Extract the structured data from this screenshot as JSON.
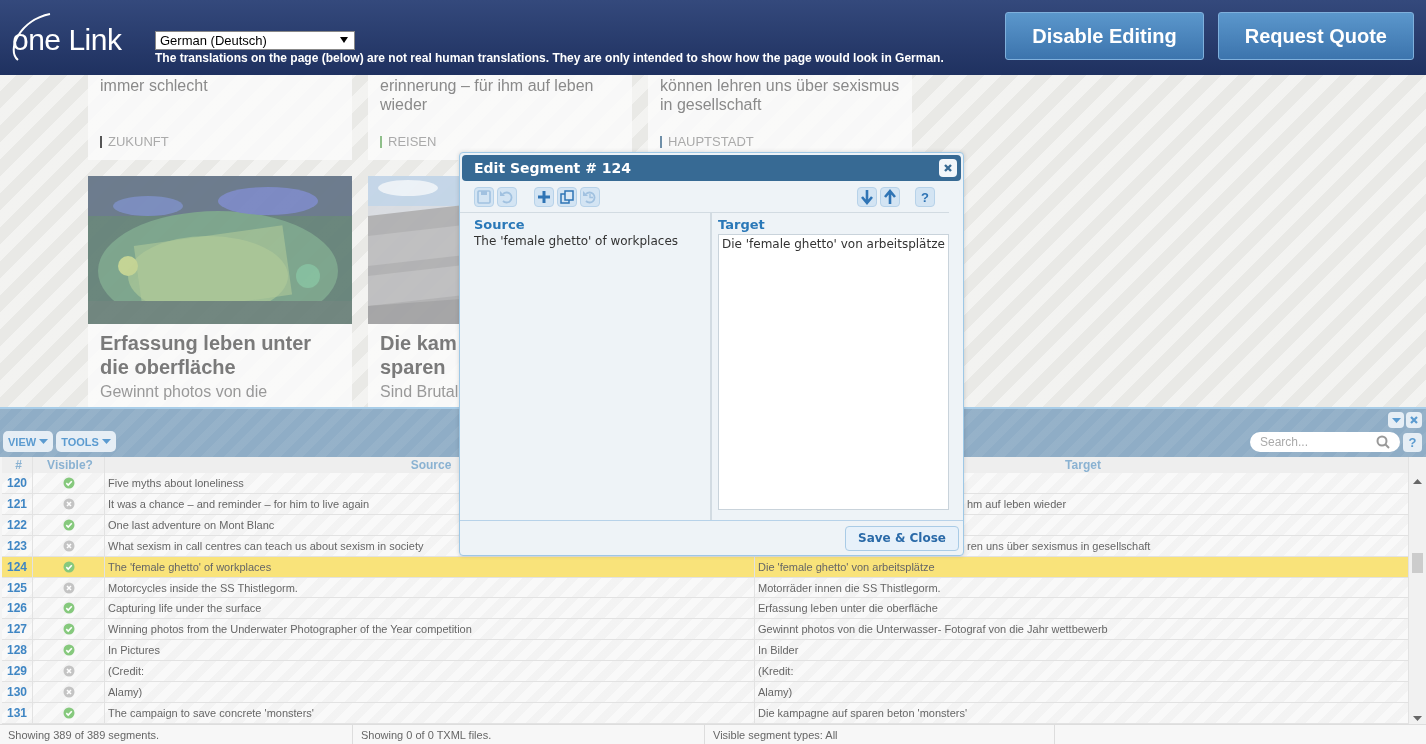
{
  "header": {
    "logo": "one Link",
    "language": "German (Deutsch)",
    "notice": "The translations on the page (below) are not real human translations. They are only intended to show how the page would look in German.",
    "buttons": [
      "Disable Editing",
      "Request Quote"
    ]
  },
  "page": {
    "top_cards": [
      {
        "snippet": "immer schlecht",
        "category": "ZUKUNFT",
        "color": "#555555"
      },
      {
        "snippet": "erinnerung – für ihm auf leben wieder",
        "category": "REISEN",
        "color": "#8fbf8a"
      },
      {
        "snippet": "können lehren uns über sexismus in gesellschaft",
        "category": "HAUPTSTADT",
        "color": "#6f8fa8"
      }
    ],
    "cards": [
      {
        "title": "Erfassung leben unter\ndie oberfläche",
        "snippet": "Gewinnt photos von die"
      },
      {
        "title": "Die kam\nsparen",
        "snippet": "Sind Brutal"
      }
    ]
  },
  "grid": {
    "toolbar": [
      "VIEW",
      "TOOLS"
    ],
    "search": {
      "placeholder": "Search..."
    },
    "help": "?",
    "columns": [
      "#",
      "Visible?",
      "Source",
      "Target"
    ],
    "rows": [
      {
        "num": "120",
        "visible": true,
        "source": "Five myths about loneliness",
        "selected": false
      },
      {
        "num": "121",
        "visible": false,
        "source": "It was a chance – and reminder – for him to live again",
        "target": "hm auf leben wieder",
        "selected": false
      },
      {
        "num": "122",
        "visible": true,
        "source": "One last adventure on Mont Blanc",
        "selected": false
      },
      {
        "num": "123",
        "visible": false,
        "source": "What sexism in call centres can teach us about sexism in society",
        "target": "ren uns über sexismus in gesellschaft",
        "selected": false
      },
      {
        "num": "124",
        "visible": true,
        "source": "The 'female ghetto' of workplaces",
        "target": "Die 'female ghetto' von arbeitsplätze",
        "selected": true
      },
      {
        "num": "125",
        "visible": false,
        "source": "Motorcycles inside the SS Thistlegorm.",
        "target": "Motorräder innen die SS Thistlegorm.",
        "selected": false
      },
      {
        "num": "126",
        "visible": true,
        "source": "Capturing life under the surface",
        "target": "Erfassung leben unter die oberfläche",
        "selected": false
      },
      {
        "num": "127",
        "visible": true,
        "source": "Winning photos from the Underwater Photographer of the Year competition",
        "target": "Gewinnt photos von die Unterwasser- Fotograf von die Jahr wettbewerb",
        "selected": false
      },
      {
        "num": "128",
        "visible": true,
        "source": "In Pictures",
        "target": "In Bilder",
        "selected": false
      },
      {
        "num": "129",
        "visible": false,
        "source": "(Credit:",
        "target": "(Kredit:",
        "selected": false
      },
      {
        "num": "130",
        "visible": false,
        "source": "Alamy)",
        "target": "Alamy)",
        "selected": false
      },
      {
        "num": "131",
        "visible": true,
        "source": "The campaign to save concrete 'monsters'",
        "target": "Die kampagne auf sparen beton 'monsters'",
        "selected": false
      }
    ],
    "status": [
      "Showing 389 of 389 segments.",
      "Showing 0 of 0 TXML files.",
      "Visible segment types: All"
    ]
  },
  "dialog": {
    "title": "Edit Segment # 124",
    "tools": [
      {
        "kind": "save",
        "disabled": true
      },
      {
        "kind": "undo",
        "disabled": true
      },
      {
        "kind": "insert",
        "disabled": false
      },
      {
        "kind": "copy",
        "disabled": false
      },
      {
        "kind": "revert",
        "disabled": true
      },
      {
        "kind": "next",
        "disabled": false
      },
      {
        "kind": "previous",
        "disabled": false
      }
    ],
    "help": "?",
    "source_label": "Source",
    "source_text": "The 'female ghetto' of workplaces",
    "target_label": "Target",
    "target_value": "Die 'female ghetto' von arbeitsplätze",
    "save_button": "Save & Close"
  }
}
